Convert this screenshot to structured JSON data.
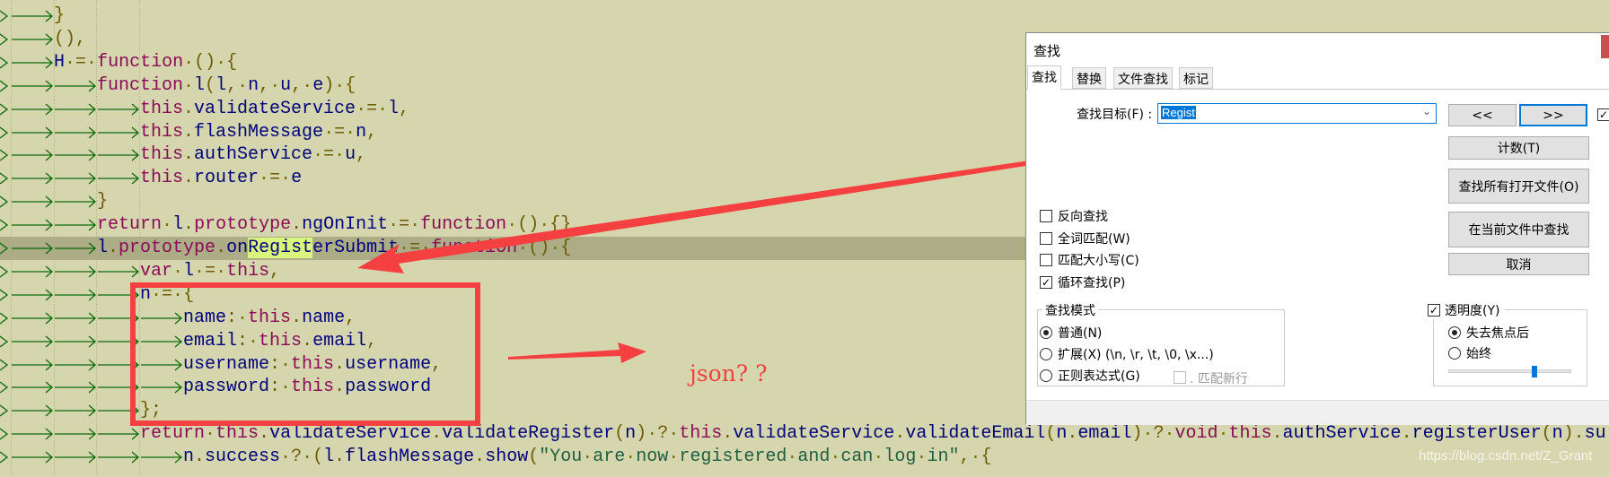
{
  "editor": {
    "highlight_term": "Regist",
    "highlighted_line": 10,
    "lines": [
      {
        "indent": 1,
        "text": "}"
      },
      {
        "indent": 1,
        "text": "(),"
      },
      {
        "indent": 1,
        "text": "H = function () {"
      },
      {
        "indent": 2,
        "text": "function l(l, n, u, e) {"
      },
      {
        "indent": 3,
        "text": "this.validateService = l,"
      },
      {
        "indent": 3,
        "text": "this.flashMessage = n,"
      },
      {
        "indent": 3,
        "text": "this.authService = u,"
      },
      {
        "indent": 3,
        "text": "this.router = e"
      },
      {
        "indent": 2,
        "text": "}"
      },
      {
        "indent": 2,
        "text": "return l.prototype.ngOnInit = function () {}"
      },
      {
        "indent": 2,
        "text": "l.prototype.onRegisterSubmit = function () {"
      },
      {
        "indent": 3,
        "text": "var l = this,"
      },
      {
        "indent": 3,
        "text": "n = {"
      },
      {
        "indent": 4,
        "text": "name: this.name,"
      },
      {
        "indent": 4,
        "text": "email: this.email,"
      },
      {
        "indent": 4,
        "text": "username: this.username,"
      },
      {
        "indent": 4,
        "text": "password: this.password"
      },
      {
        "indent": 3,
        "text": "};"
      },
      {
        "indent": 3,
        "text": "return this.validateService.validateRegister(n) ? this.validateService.validateEmail(n.email) ? void this.authService.registerUser(n).su"
      },
      {
        "indent": 4,
        "text": "n.success ? (l.flashMessage.show(\"You are now registered and can log in\", {"
      }
    ]
  },
  "annotation": {
    "note": "json? ?",
    "color": "#f44040"
  },
  "dialog": {
    "title": "查找",
    "tabs": [
      "查找",
      "替换",
      "文件查找",
      "标记"
    ],
    "active_tab": 0,
    "find_label": "查找目标(F) :",
    "find_value": "Regist",
    "buttons": {
      "prev": "<<",
      "next": ">>",
      "count": "计数(T)",
      "find_all_open": "查找所有打开文件(O)",
      "find_in_current": "在当前文件中查找",
      "cancel": "取消"
    },
    "options": [
      {
        "label": "反向查找",
        "checked": false
      },
      {
        "label": "全词匹配(W)",
        "checked": false
      },
      {
        "label": "匹配大小写(C)",
        "checked": false
      },
      {
        "label": "循环查找(P)",
        "checked": true
      }
    ],
    "search_mode": {
      "title": "查找模式",
      "modes": [
        {
          "label": "普通(N)",
          "selected": true
        },
        {
          "label": "扩展(X) (\\n, \\r, \\t, \\0, \\x...)",
          "selected": false
        },
        {
          "label": "正则表达式(G)",
          "selected": false
        }
      ],
      "match_newline": ". 匹配新行"
    },
    "transparency": {
      "label": "透明度(Y)",
      "checked": true,
      "modes": [
        {
          "label": "失去焦点后",
          "selected": true
        },
        {
          "label": "始终",
          "selected": false
        }
      ],
      "level": 0.7
    }
  },
  "watermark": "https://blog.csdn.net/Z_Grant",
  "colors": {
    "editor_bg": "#d6d6ae",
    "keyword": "#8a0b56",
    "identifier": "#00007a",
    "accent": "#0078d7"
  }
}
